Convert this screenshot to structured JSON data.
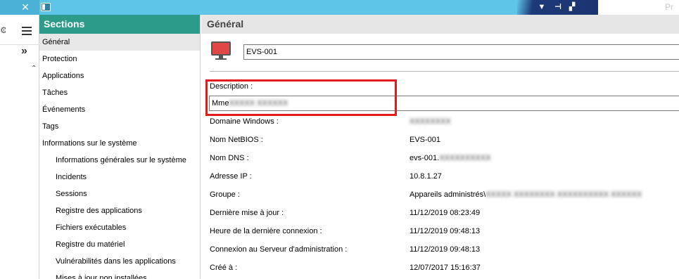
{
  "titlebar": {
    "close_glyph": "✕",
    "pr_text": "Pr"
  },
  "sections": {
    "header": "Sections",
    "items": [
      {
        "label": "Général",
        "selected": true,
        "sub": false
      },
      {
        "label": "Protection",
        "sub": false
      },
      {
        "label": "Applications",
        "sub": false
      },
      {
        "label": "Tâches",
        "sub": false
      },
      {
        "label": "Événements",
        "sub": false
      },
      {
        "label": "Tags",
        "sub": false
      },
      {
        "label": "Informations sur le système",
        "sub": false
      },
      {
        "label": "Informations générales sur le système",
        "sub": true
      },
      {
        "label": "Incidents",
        "sub": true
      },
      {
        "label": "Sessions",
        "sub": true
      },
      {
        "label": "Registre des applications",
        "sub": true
      },
      {
        "label": "Fichiers exécutables",
        "sub": true
      },
      {
        "label": "Registre du matériel",
        "sub": true
      },
      {
        "label": "Vulnérabilités dans les applications",
        "sub": true
      },
      {
        "label": "Mises à jour non installées",
        "sub": true
      }
    ]
  },
  "main": {
    "header": "Général",
    "device_name": "EVS-001",
    "description_label": "Description :",
    "description_value": "Mme",
    "properties": [
      {
        "label": "Domaine Windows :",
        "value": ""
      },
      {
        "label": "Nom NetBIOS :",
        "value": "EVS-001"
      },
      {
        "label": "Nom DNS :",
        "value": "evs-001."
      },
      {
        "label": "Adresse IP :",
        "value": "10.8.1.27"
      },
      {
        "label": "Groupe :",
        "value": "Appareils administrés\\"
      },
      {
        "label": "Dernière mise à jour :",
        "value": "11/12/2019 08:23:49"
      },
      {
        "label": "Heure de la dernière connexion :",
        "value": "11/12/2019 09:48:13"
      },
      {
        "label": "Connexion au Serveur d'administration :",
        "value": "11/12/2019 09:48:13"
      },
      {
        "label": "Créé à :",
        "value": "12/07/2017 15:16:37"
      }
    ]
  },
  "colors": {
    "sections_header": "#2c9b8a",
    "titlebar": "#5ec4e8",
    "highlight": "#e21b1b",
    "pc_icon": "#e04848"
  }
}
